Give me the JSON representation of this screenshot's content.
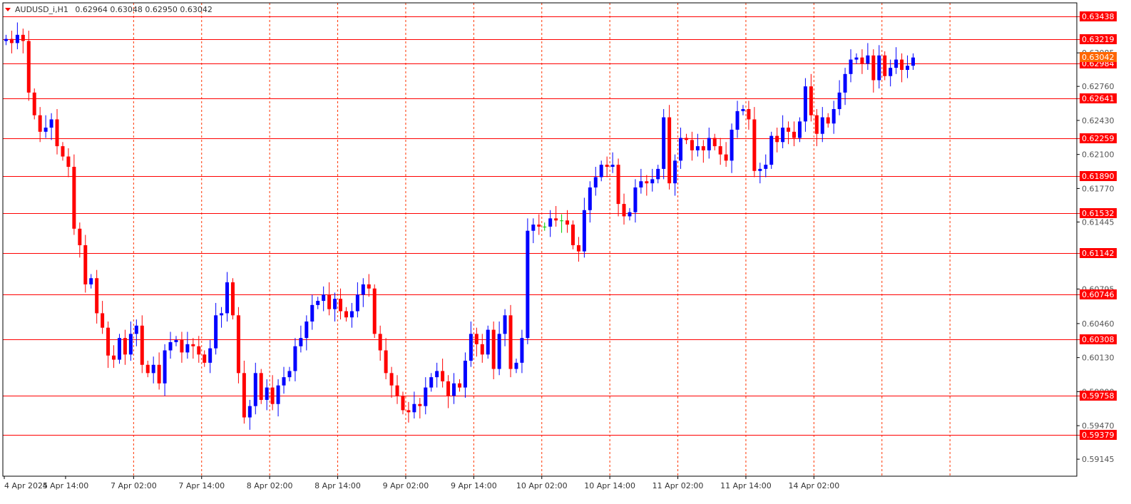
{
  "header": {
    "arrow_icon": "triangle-down-icon",
    "symbol_text": "AUDUSD_i,H1",
    "ohlc_text": "0.62964 0.63048 0.62950 0.63042"
  },
  "colors": {
    "background": "#ffffff",
    "axis": "#000000",
    "grid": "#ff3300",
    "level_line": "#ff0000",
    "bull": "#0000ff",
    "bear": "#ff0000",
    "neutral": "#00cc00",
    "label_bg": "#ff0000",
    "label_text": "#ffffff",
    "tick_text": "#555555",
    "time_text": "#333333"
  },
  "chart_data": {
    "type": "candlestick",
    "symbol": "AUDUSD_i",
    "timeframe": "H1",
    "ylim": [
      0.5898,
      0.6357
    ],
    "y_ticks": [
      "0.63085",
      "0.62760",
      "0.62430",
      "0.62100",
      "0.61770",
      "0.61445",
      "0.60795",
      "0.60460",
      "0.60130",
      "0.59800",
      "0.59470",
      "0.59145"
    ],
    "levels": [
      "0.63438",
      "0.63219",
      "0.62984",
      "0.62641",
      "0.62259",
      "0.61890",
      "0.61532",
      "0.61142",
      "0.60746",
      "0.60308",
      "0.59758",
      "0.59379"
    ],
    "current_price": "0.63042",
    "x_ticks": [
      "4 Apr 2025",
      "4 Apr 14:00",
      "7 Apr 02:00",
      "7 Apr 14:00",
      "8 Apr 02:00",
      "8 Apr 14:00",
      "9 Apr 02:00",
      "9 Apr 14:00",
      "10 Apr 02:00",
      "10 Apr 14:00",
      "11 Apr 02:00",
      "11 Apr 14:00",
      "14 Apr 02:00"
    ],
    "grid_ticks": [
      "4 Apr 14:00",
      "7 Apr 02:00",
      "7 Apr 14:00",
      "8 Apr 02:00",
      "8 Apr 14:00",
      "9 Apr 02:00",
      "9 Apr 14:00",
      "10 Apr 02:00",
      "10 Apr 14:00",
      "11 Apr 02:00",
      "11 Apr 14:00",
      "14 Apr 02:00",
      "14 Apr 14:00"
    ],
    "closes": [
      0.6322,
      0.6318,
      0.6326,
      0.632,
      0.627,
      0.6248,
      0.6232,
      0.6236,
      0.6244,
      0.6218,
      0.6208,
      0.6198,
      0.6138,
      0.6122,
      0.6084,
      0.609,
      0.6056,
      0.6042,
      0.6015,
      0.6011,
      0.6032,
      0.6016,
      0.6036,
      0.6044,
      0.6006,
      0.5998,
      0.6006,
      0.5988,
      0.602,
      0.6028,
      0.603,
      0.6018,
      0.6026,
      0.6024,
      0.6016,
      0.6008,
      0.6022,
      0.6054,
      0.6056,
      0.6086,
      0.6054,
      0.5998,
      0.5955,
      0.5966,
      0.5998,
      0.5972,
      0.5984,
      0.5968,
      0.5986,
      0.5994,
      0.6,
      0.6024,
      0.6032,
      0.6048,
      0.6064,
      0.6068,
      0.6074,
      0.606,
      0.607,
      0.6058,
      0.6052,
      0.6058,
      0.6074,
      0.6084,
      0.608,
      0.6036,
      0.602,
      0.5998,
      0.5986,
      0.5976,
      0.5962,
      0.596,
      0.5968,
      0.5966,
      0.5984,
      0.5994,
      0.6,
      0.599,
      0.5976,
      0.5988,
      0.5984,
      0.601,
      0.6036,
      0.6026,
      0.6016,
      0.604,
      0.6002,
      0.6036,
      0.6054,
      0.6002,
      0.6008,
      0.6032,
      0.6136,
      0.6142,
      0.614,
      0.614,
      0.6148,
      0.6146,
      0.6146,
      0.6142,
      0.6122,
      0.6116,
      0.6156,
      0.6178,
      0.6188,
      0.62,
      0.6198,
      0.62,
      0.6162,
      0.615,
      0.6154,
      0.6178,
      0.6184,
      0.6182,
      0.6186,
      0.6196,
      0.6246,
      0.6182,
      0.6204,
      0.6226,
      0.6224,
      0.6214,
      0.6218,
      0.6214,
      0.6226,
      0.6218,
      0.621,
      0.6204,
      0.6234,
      0.6252,
      0.6254,
      0.6244,
      0.6194,
      0.6196,
      0.62,
      0.6228,
      0.6222,
      0.6236,
      0.6232,
      0.6226,
      0.6242,
      0.6276,
      0.6248,
      0.623,
      0.6246,
      0.624,
      0.6254,
      0.627,
      0.6288,
      0.6302,
      0.6304,
      0.6298,
      0.6306,
      0.6282,
      0.6306,
      0.6286,
      0.6294,
      0.6302,
      0.6292,
      0.6296,
      0.6304
    ]
  }
}
